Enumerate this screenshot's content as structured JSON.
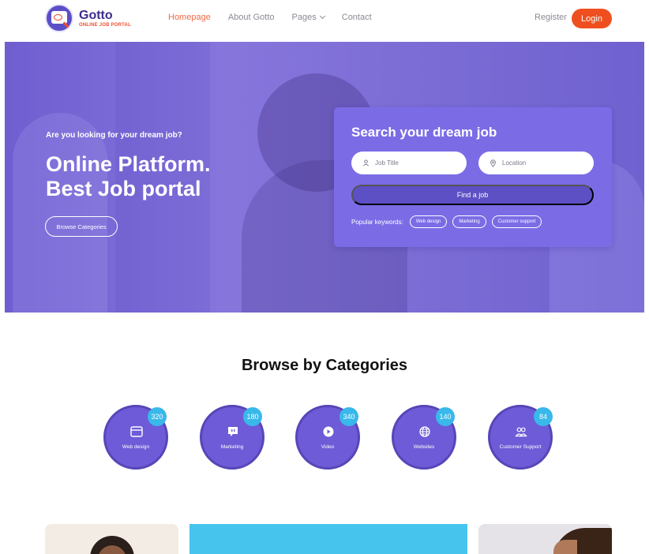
{
  "brand": {
    "name": "Gotto",
    "tagline": "ONLINE JOB PORTAL"
  },
  "nav": {
    "items": [
      {
        "label": "Homepage",
        "active": true
      },
      {
        "label": "About Gotto",
        "active": false
      },
      {
        "label": "Pages",
        "active": false,
        "dropdown": true
      },
      {
        "label": "Contact",
        "active": false
      }
    ],
    "register": "Register",
    "login": "Login"
  },
  "hero": {
    "eyebrow": "Are you looking for your dream job?",
    "title_line1": "Online Platform.",
    "title_line2": "Best Job portal",
    "browse_button": "Browse Categories"
  },
  "search": {
    "title": "Search your dream job",
    "job_placeholder": "Job Title",
    "location_placeholder": "Location",
    "find_button": "Find a job",
    "keywords_label": "Popular keywords:",
    "keywords": [
      "Web design",
      "Marketing",
      "Customer support"
    ]
  },
  "categories": {
    "title": "Browse by Categories",
    "items": [
      {
        "label": "Web design",
        "count": "320",
        "icon": "browser-window-icon"
      },
      {
        "label": "Marketing",
        "count": "180",
        "icon": "chat-bubble-icon"
      },
      {
        "label": "Video",
        "count": "340",
        "icon": "play-icon"
      },
      {
        "label": "Websites",
        "count": "140",
        "icon": "globe-icon"
      },
      {
        "label": "Customer Support",
        "count": "84",
        "icon": "users-icon"
      }
    ]
  },
  "colors": {
    "accent": "#ef4f1f",
    "brand_purple": "#6d5bd7",
    "badge_blue": "#39b8ea"
  }
}
